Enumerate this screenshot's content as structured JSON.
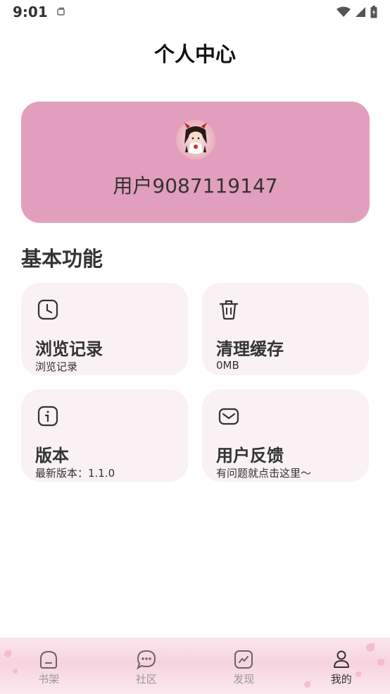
{
  "status_bar": {
    "time": "9:01"
  },
  "header": {
    "title": "个人中心"
  },
  "profile": {
    "username": "用户9087119147"
  },
  "basic_functions": {
    "title": "基本功能",
    "tiles": [
      {
        "icon": "clock-icon",
        "title": "浏览记录",
        "subtitle": "浏览记录"
      },
      {
        "icon": "trash-icon",
        "title": "清理缓存",
        "subtitle": "0MB"
      },
      {
        "icon": "info-icon",
        "title": "版本",
        "subtitle": "最新版本：1.1.0"
      },
      {
        "icon": "mail-icon",
        "title": "用户反馈",
        "subtitle": "有问题就点击这里～"
      }
    ]
  },
  "bottom_nav": {
    "items": [
      {
        "label": "书架",
        "icon": "bookshelf-icon",
        "active": false
      },
      {
        "label": "社区",
        "icon": "chat-bubble-icon",
        "active": false
      },
      {
        "label": "发现",
        "icon": "trend-chart-icon",
        "active": false
      },
      {
        "label": "我的",
        "icon": "person-icon",
        "active": true
      }
    ]
  },
  "colors": {
    "profile_card": "#e29fbd",
    "tile_background": "#f9f1f3",
    "nav_active": "#333333",
    "nav_inactive": "#9a9a9a"
  }
}
